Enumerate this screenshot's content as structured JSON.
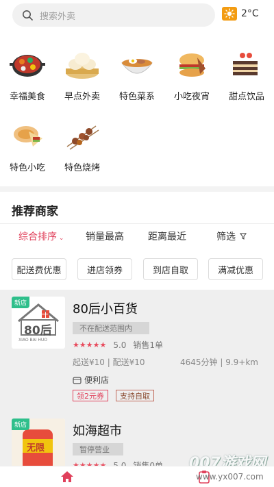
{
  "search": {
    "placeholder": "搜索外卖",
    "icon": "search-icon"
  },
  "weather": {
    "temp": "2°C",
    "icon": "sun-icon",
    "color": "#f39c12"
  },
  "categories": [
    {
      "label": "幸福美食",
      "icon": "hotpot-icon"
    },
    {
      "label": "早点外卖",
      "icon": "steamed-bun-icon"
    },
    {
      "label": "特色菜系",
      "icon": "noodle-bowl-icon"
    },
    {
      "label": "小吃夜宵",
      "icon": "burger-icon"
    },
    {
      "label": "甜点饮品",
      "icon": "cake-icon"
    },
    {
      "label": "特色小吃",
      "icon": "sandwich-icon"
    },
    {
      "label": "特色烧烤",
      "icon": "skewer-icon"
    }
  ],
  "recommend": {
    "title": "推荐商家",
    "sort": [
      {
        "label": "综合排序",
        "active": true
      },
      {
        "label": "销量最高"
      },
      {
        "label": "距离最近"
      },
      {
        "label": "筛选"
      }
    ],
    "filters": [
      "配送费优惠",
      "进店领券",
      "到店自取",
      "满减优惠"
    ]
  },
  "shops": [
    {
      "badge": "新店",
      "logo_text": "80后",
      "logo_sub": "XIAO BAI HUO",
      "name": "80后小百货",
      "state": "不在配送范围内",
      "stars": "★★★★★",
      "score": "5.0",
      "sales": "销售1单",
      "fee": "起送¥10 | 配送¥10",
      "distance": "4645分钟 | 9.9+km",
      "type": "便利店",
      "tags": [
        "领2元券",
        "支持自取"
      ]
    },
    {
      "badge": "新店",
      "logo_text": "无限",
      "name": "如海超市",
      "state": "暂停营业",
      "stars": "★★★★★",
      "score": "5.0",
      "sales": "销售0单"
    }
  ],
  "watermark": {
    "main": "007游戏网",
    "sub": "www.yx007.com"
  },
  "colors": {
    "accent": "#e0405b",
    "badge": "#2fbf8b"
  }
}
